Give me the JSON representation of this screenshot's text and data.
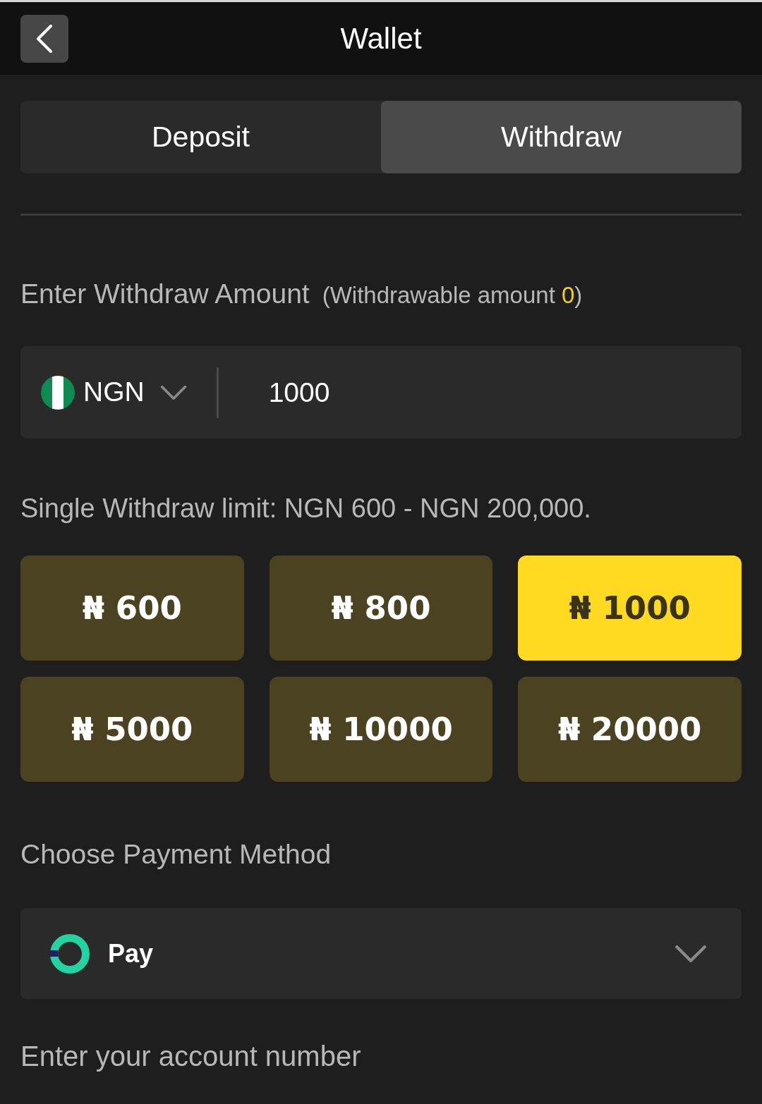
{
  "header": {
    "title": "Wallet"
  },
  "tabs": [
    {
      "label": "Deposit",
      "selected": false
    },
    {
      "label": "Withdraw",
      "selected": true
    }
  ],
  "amount_section": {
    "label": "Enter Withdraw Amount",
    "withdrawable": {
      "prefix": "(Withdrawable amount",
      "value": "0",
      "suffix": ")"
    }
  },
  "amount_field": {
    "currency": "NGN",
    "value": "1000"
  },
  "limit_text": "Single Withdraw limit: NGN 600 - NGN 200,000.",
  "presets": [
    {
      "label": "₦ 600",
      "selected": false
    },
    {
      "label": "₦ 800",
      "selected": false
    },
    {
      "label": "₦ 1000",
      "selected": true
    },
    {
      "label": "₦ 5000",
      "selected": false
    },
    {
      "label": "₦ 10000",
      "selected": false
    },
    {
      "label": "₦ 20000",
      "selected": false
    }
  ],
  "payment": {
    "label": "Choose Payment Method",
    "method": "Pay"
  },
  "account": {
    "label": "Enter your account number"
  }
}
